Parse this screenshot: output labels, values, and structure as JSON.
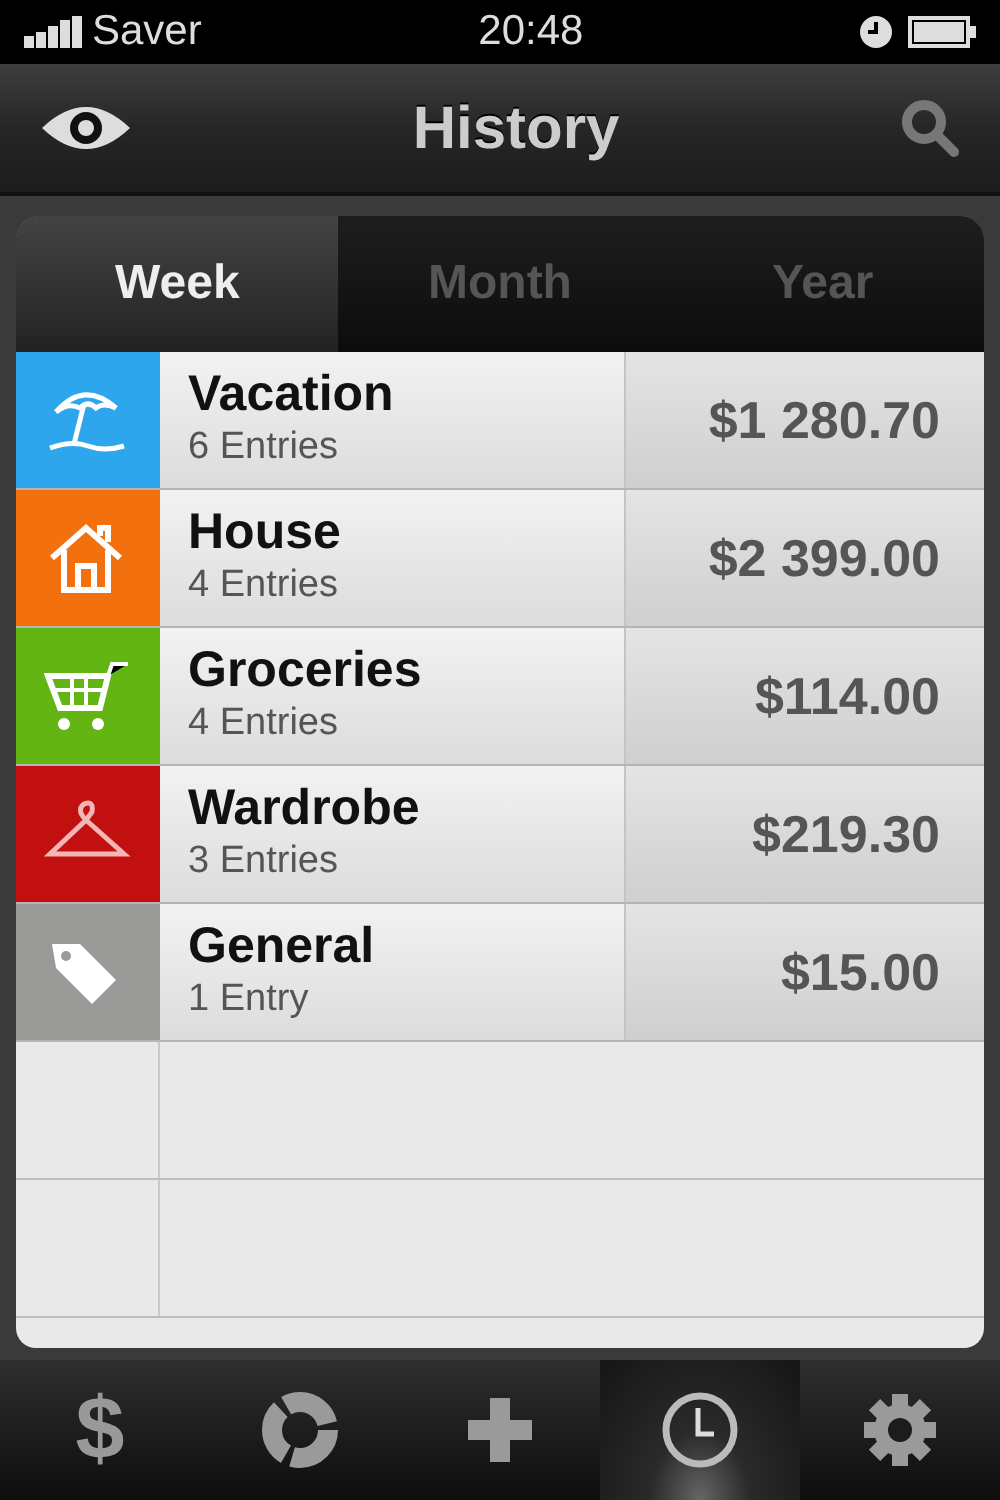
{
  "status_bar": {
    "carrier": "Saver",
    "time": "20:48"
  },
  "nav": {
    "title": "History"
  },
  "segments": [
    {
      "label": "Week",
      "selected": true
    },
    {
      "label": "Month",
      "selected": false
    },
    {
      "label": "Year",
      "selected": false
    }
  ],
  "categories": [
    {
      "kind": "beach",
      "color": "#2ea6ee",
      "name": "Vacation",
      "entries": "6 Entries",
      "amount": "$1 280.70"
    },
    {
      "kind": "home",
      "color": "#f2700e",
      "name": "House",
      "entries": "4 Entries",
      "amount": "$2 399.00"
    },
    {
      "kind": "cart",
      "color": "#62b512",
      "name": "Groceries",
      "entries": "4 Entries",
      "amount": "$114.00"
    },
    {
      "kind": "hanger",
      "color": "#c21010",
      "name": "Wardrobe",
      "entries": "3 Entries",
      "amount": "$219.30"
    },
    {
      "kind": "tag",
      "color": "#9a9a98",
      "name": "General",
      "entries": "1 Entry",
      "amount": "$15.00"
    }
  ],
  "tab_bar": [
    {
      "kind": "text",
      "label": "$",
      "selected": false
    },
    {
      "kind": "donut",
      "selected": false
    },
    {
      "kind": "plus",
      "selected": false
    },
    {
      "kind": "clock",
      "selected": true
    },
    {
      "kind": "gear",
      "selected": false
    }
  ]
}
